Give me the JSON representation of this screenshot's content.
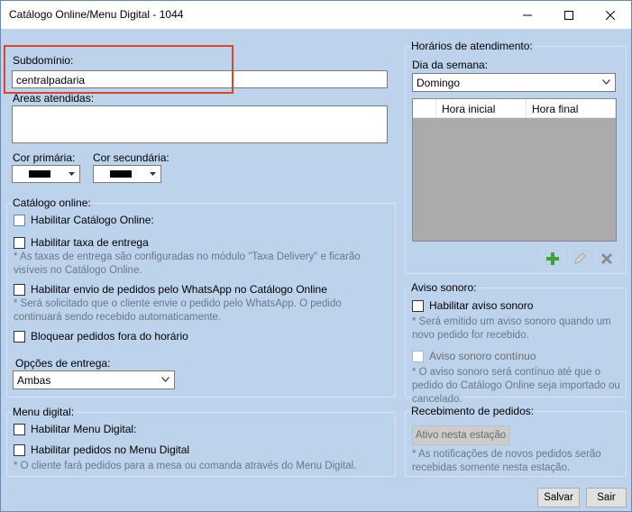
{
  "window": {
    "title": "Catálogo Online/Menu Digital - 1044"
  },
  "general": {
    "subdomain_label": "Subdomínio:",
    "subdomain_value": "centralpadaria",
    "areas_label": "Áreas atendidas:",
    "areas_value": "",
    "primary_color_label": "Cor primária:",
    "secondary_color_label": "Cor secundária:",
    "primary_color": "#000000",
    "secondary_color": "#000000"
  },
  "catalog": {
    "group_label": "Catálogo online:",
    "enable_catalog": "Habilitar Catálogo Online:",
    "enable_delivery_fee": "Habilitar taxa de entrega",
    "delivery_note": "* As taxas de entrega são configuradas no módulo \"Taxa Delivery\" e ficarão visíveis no Catálogo Online.",
    "enable_whatsapp": "Habilitar envio de pedidos pelo WhatsApp no Catálogo Online",
    "whatsapp_note": "* Será solicitado que o cliente envie o pedido pelo WhatsApp. O pedido continuará sendo recebido automaticamente.",
    "block_outside_hours": "Bloquear pedidos fora do horário",
    "delivery_options_label": "Opções de entrega:",
    "delivery_options_value": "Ambas"
  },
  "menu": {
    "group_label": "Menu digital:",
    "enable_menu": "Habilitar Menu Digital:",
    "enable_menu_orders": "Habilitar pedidos no Menu Digital",
    "menu_note": "* O cliente fará pedidos para a mesa ou comanda através do Menu Digital."
  },
  "hours": {
    "group_label": "Horários de atendimento:",
    "weekday_label": "Dia da semana:",
    "weekday_value": "Domingo",
    "col_start": "Hora inicial",
    "col_end": "Hora final"
  },
  "sound": {
    "group_label": "Aviso sonoro:",
    "enable_sound": "Habilitar aviso sonoro",
    "sound_note": "* Será emitido um aviso sonoro quando um novo pedido for recebido.",
    "continuous_sound": "Aviso sonoro contínuo",
    "continuous_note": "* O aviso sonoro será contínuo até que o pedido do Catálogo Online seja importado ou cancelado."
  },
  "receiving": {
    "group_label": "Recebimento de pedidos:",
    "station_button": "Ativo nesta estação",
    "station_note": "* As notificações de novos pedidos serão recebidas somente nesta estação."
  },
  "footer": {
    "save": "Salvar",
    "exit": "Sair"
  }
}
